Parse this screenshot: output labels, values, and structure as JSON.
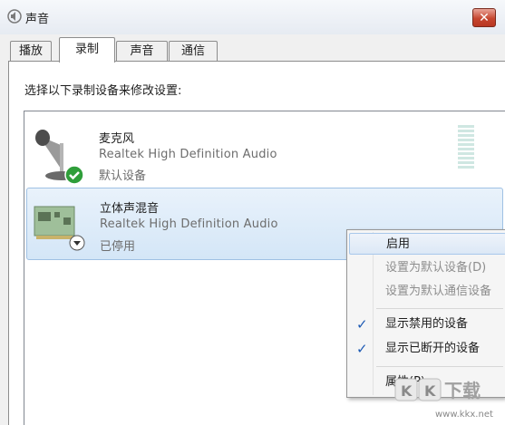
{
  "window": {
    "title": "声音",
    "close_label": "✕"
  },
  "tabs": [
    {
      "label": "播放",
      "active": false
    },
    {
      "label": "录制",
      "active": true
    },
    {
      "label": "声音",
      "active": false
    },
    {
      "label": "通信",
      "active": false
    }
  ],
  "instruction": "选择以下录制设备来修改设置:",
  "devices": [
    {
      "name": "麦克风",
      "driver": "Realtek High Definition Audio",
      "status": "默认设备",
      "icon": "microphone-icon",
      "badge": "default-check-icon",
      "selected": false
    },
    {
      "name": "立体声混音",
      "driver": "Realtek High Definition Audio",
      "status": "已停用",
      "icon": "sound-card-icon",
      "badge": "disabled-arrow-icon",
      "selected": true
    }
  ],
  "context_menu": {
    "items": [
      {
        "label": "启用",
        "enabled": true,
        "checked": false
      },
      {
        "label": "设置为默认设备(D)",
        "enabled": false,
        "checked": false
      },
      {
        "label": "设置为默认通信设备",
        "enabled": false,
        "checked": false
      },
      {
        "label": "显示禁用的设备",
        "enabled": true,
        "checked": true
      },
      {
        "label": "显示已断开的设备",
        "enabled": true,
        "checked": true
      },
      {
        "label": "属性(P)",
        "enabled": true,
        "checked": false
      }
    ],
    "check_glyph": "✓"
  },
  "watermark": {
    "text": "KK下载",
    "url": "www.kkx.net"
  },
  "colors": {
    "accent": "#1e5bb4",
    "selection": "#d4e6f7",
    "close": "#c6462f"
  }
}
